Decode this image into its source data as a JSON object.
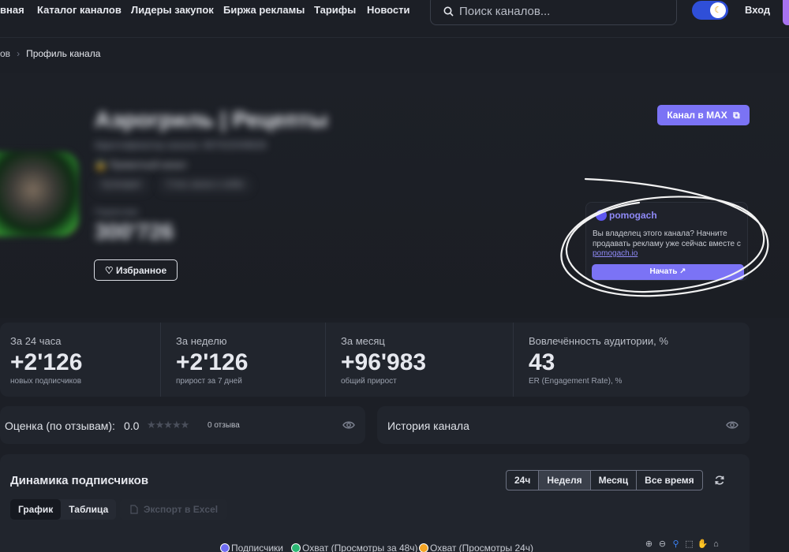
{
  "nav": {
    "items": [
      "вная",
      "Каталог каналов",
      "Лидеры закупок",
      "Биржа рекламы",
      "Тарифы",
      "Новости"
    ],
    "search_placeholder": "Поиск каналов...",
    "login": "Вход",
    "theme_toggle_on": true
  },
  "breadcrumb": {
    "prev": "ов",
    "current": "Профиль канала"
  },
  "channel": {
    "title": "Аэрогриль | Рецепты",
    "id_line": "Идентификатор канала: 667022049628",
    "type": "Приватный канал",
    "tags": [
      "Кулинария",
      "Стиль жизни и хобби"
    ],
    "subs_label": "Подписчики",
    "subs_value": "300'726",
    "fav_label": "Избранное",
    "max_button": "Канал в MAX"
  },
  "promo": {
    "logo": "pomogach",
    "text": "Вы владелец этого канала? Начните продавать рекламу уже сейчас вместе с",
    "link": "pomogach.io",
    "button": "Начать ↗"
  },
  "stats": [
    {
      "label": "За 24 часа",
      "value": "+2'126",
      "sub": "новых подписчиков"
    },
    {
      "label": "За неделю",
      "value": "+2'126",
      "sub": "прирост за 7 дней"
    },
    {
      "label": "За месяц",
      "value": "+96'983",
      "sub": "общий прирост"
    },
    {
      "label": "Вовлечённость аудитории, %",
      "value": "43",
      "sub": "ER (Engagement Rate), %"
    }
  ],
  "rating": {
    "label": "Оценка (по отзывам):",
    "value": "0.0",
    "stars": 0,
    "reviews": "0 отзыва"
  },
  "history": {
    "label": "История канала"
  },
  "dynamics": {
    "title": "Динамика подписчиков",
    "periods": [
      "24ч",
      "Неделя",
      "Месяц",
      "Все время"
    ],
    "active_period": "Неделя",
    "views": [
      "График",
      "Таблица"
    ],
    "active_view": "График",
    "export": "Экспорт в Excel",
    "legend": [
      {
        "name": "Подписчики",
        "color": "#6f6cf2"
      },
      {
        "name": "Охват (Просмотры за 48ч)",
        "color": "#2bb673"
      },
      {
        "name": "Охват (Просмотры 24ч)",
        "color": "#f5a524"
      }
    ]
  },
  "colors": {
    "accent": "#7b73f5",
    "background": "#1c1f26",
    "card": "#21252d"
  }
}
